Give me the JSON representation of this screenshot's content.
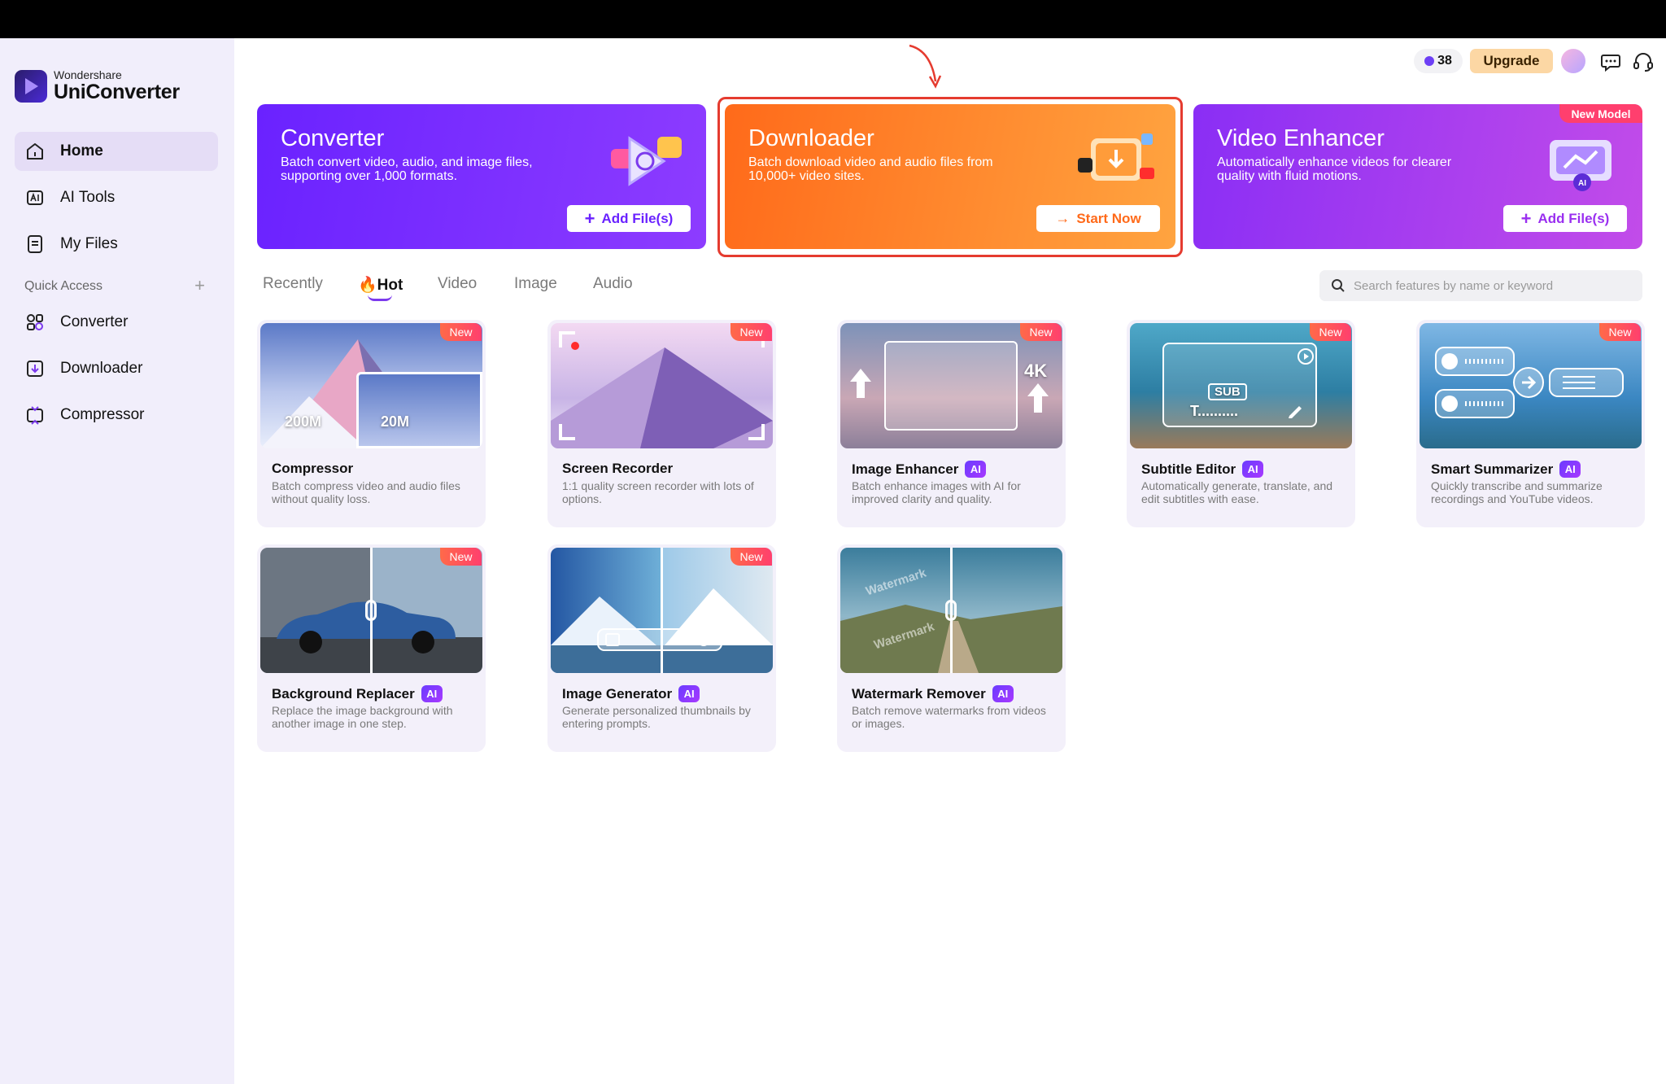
{
  "app": {
    "brand_small": "Wondershare",
    "brand_big": "UniConverter"
  },
  "sidebar": {
    "items": [
      {
        "label": "Home",
        "icon": "home-icon",
        "active": true
      },
      {
        "label": "AI Tools",
        "icon": "ai-tools-icon",
        "active": false
      },
      {
        "label": "My Files",
        "icon": "files-icon",
        "active": false
      }
    ],
    "quick_access_label": "Quick Access",
    "quick_access_add": "+",
    "quick_items": [
      {
        "label": "Converter",
        "icon": "converter-icon"
      },
      {
        "label": "Downloader",
        "icon": "downloader-icon"
      },
      {
        "label": "Compressor",
        "icon": "compressor-icon"
      }
    ]
  },
  "header": {
    "coins": "38",
    "upgrade_label": "Upgrade"
  },
  "banners": [
    {
      "title": "Converter",
      "desc": "Batch convert video, audio, and image files, supporting over 1,000 formats.",
      "button": "Add File(s)",
      "button_color": "#6a22ff"
    },
    {
      "title": "Downloader",
      "desc": "Batch download video and audio files from 10,000+ video sites.",
      "button": "Start Now",
      "button_color": "#ff6a1a"
    },
    {
      "title": "Video Enhancer",
      "desc": "Automatically enhance videos for clearer quality with fluid motions.",
      "button": "Add File(s)",
      "badge": "New Model",
      "button_color": "#9a2ff0"
    }
  ],
  "tabs": [
    {
      "label": "Recently"
    },
    {
      "label": "Hot",
      "active": true
    },
    {
      "label": "Video"
    },
    {
      "label": "Image"
    },
    {
      "label": "Audio"
    }
  ],
  "search": {
    "placeholder": "Search features by name or keyword"
  },
  "new_badge": "New",
  "ai_badge": "AI",
  "cards": [
    {
      "title": "Compressor",
      "desc": "Batch compress video and audio files without quality loss.",
      "new": true,
      "ai": false,
      "overlay_a": "200M",
      "overlay_b": "20M"
    },
    {
      "title": "Screen Recorder",
      "desc": "1:1 quality screen recorder with lots of options.",
      "new": true,
      "ai": false
    },
    {
      "title": "Image Enhancer",
      "desc": "Batch enhance images with AI for improved clarity and quality.",
      "new": true,
      "ai": true,
      "overlay_a": "4K"
    },
    {
      "title": "Subtitle Editor",
      "desc": "Automatically generate, translate, and edit subtitles with ease.",
      "new": true,
      "ai": true,
      "overlay_a": "SUB",
      "overlay_b": "T.........."
    },
    {
      "title": "Smart Summarizer",
      "desc": "Quickly transcribe and summarize recordings and YouTube videos.",
      "new": true,
      "ai": true
    },
    {
      "title": "Background Replacer",
      "desc": "Replace the image background with another image in one step.",
      "new": true,
      "ai": true
    },
    {
      "title": "Image Generator",
      "desc": "Generate personalized thumbnails by entering prompts.",
      "new": true,
      "ai": true
    },
    {
      "title": "Watermark Remover",
      "desc": "Batch remove watermarks from videos or images.",
      "new": false,
      "ai": true,
      "overlay_a": "Watermark"
    }
  ],
  "colors": {
    "accent": "#7c3aed",
    "highlight_box": "#e53b2f",
    "sidebar_bg": "#f1eefb"
  }
}
